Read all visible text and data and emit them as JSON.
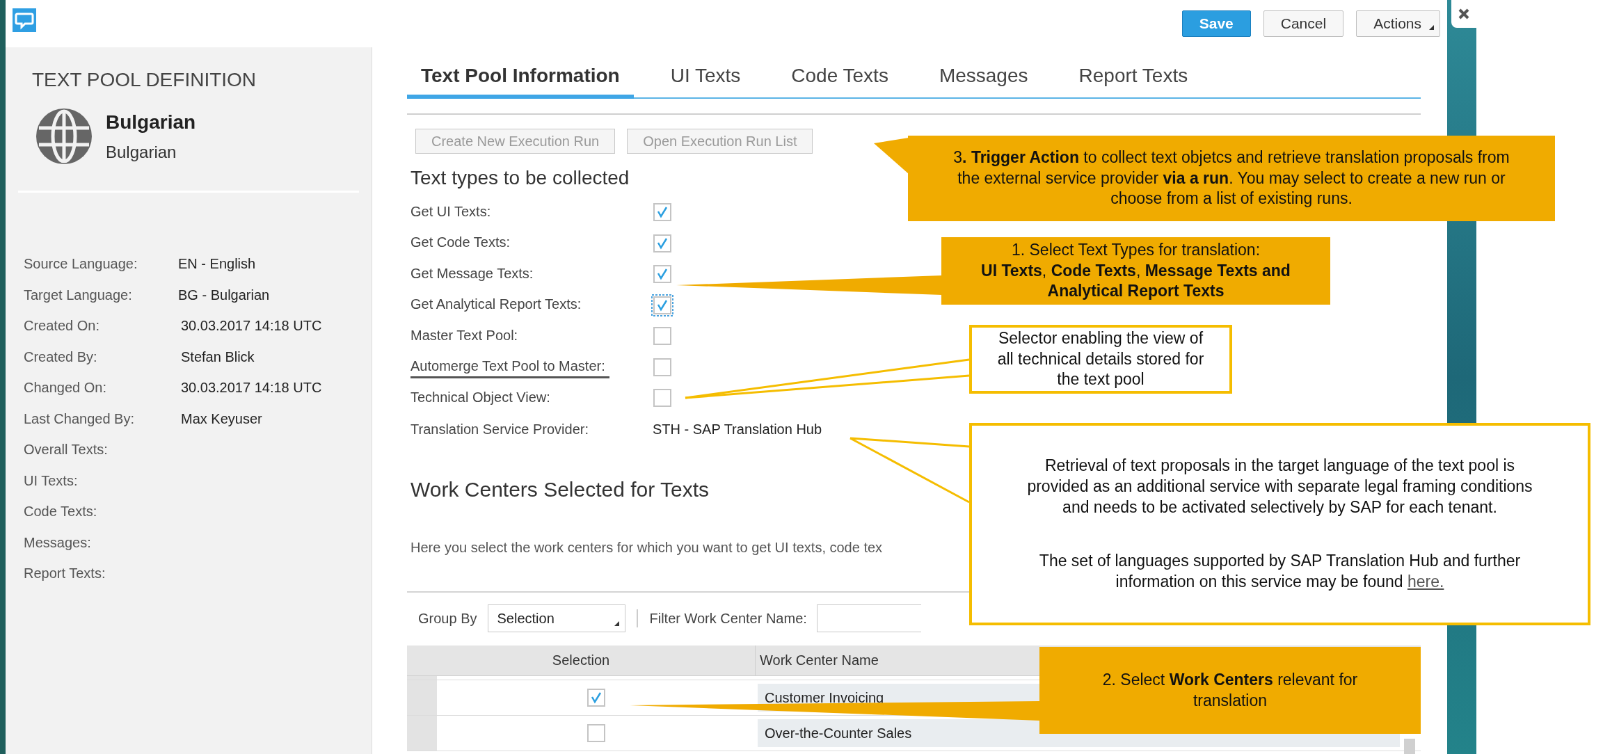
{
  "header": {
    "buttons": [
      {
        "label": "Save",
        "kind": "primary"
      },
      {
        "label": "Cancel",
        "kind": "default"
      },
      {
        "label": "Actions",
        "kind": "menu"
      }
    ]
  },
  "sidebar": {
    "title": "TEXT POOL DEFINITION",
    "language": {
      "name": "Bulgarian",
      "subtitle": "Bulgarian"
    },
    "fields": [
      {
        "label": "Source Language:",
        "value": "EN - English"
      },
      {
        "label": "Target Language:",
        "value": "BG - Bulgarian"
      },
      {
        "label": "Created On:",
        "value": "30.03.2017 14:18 UTC"
      },
      {
        "label": "Created By:",
        "value": "Stefan Blick"
      },
      {
        "label": "Changed On:",
        "value": "30.03.2017 14:18 UTC"
      },
      {
        "label": "Last Changed By:",
        "value": "Max Keyuser"
      },
      {
        "label": "Overall Texts:"
      },
      {
        "label": "UI Texts:"
      },
      {
        "label": "Code Texts:"
      },
      {
        "label": "Messages:"
      },
      {
        "label": "Report Texts:"
      }
    ]
  },
  "tabs": [
    {
      "label": "Text Pool Information",
      "selected": true
    },
    {
      "label": "UI Texts",
      "selected": false
    },
    {
      "label": "Code Texts",
      "selected": false
    },
    {
      "label": "Messages",
      "selected": false
    },
    {
      "label": "Report Texts",
      "selected": false
    }
  ],
  "actions": [
    {
      "label": "Create New Execution Run",
      "disabled": true
    },
    {
      "label": "Open Execution Run List",
      "disabled": true
    }
  ],
  "text_types": {
    "heading": "Text types to be collected",
    "options": [
      {
        "label": "Get UI Texts:",
        "checked": true,
        "focused": false,
        "highlighted": false
      },
      {
        "label": "Get Code Texts:",
        "checked": true,
        "focused": false,
        "highlighted": false
      },
      {
        "label": "Get Message Texts:",
        "checked": true,
        "focused": false,
        "highlighted": false
      },
      {
        "label": "Get Analytical Report Texts:",
        "checked": true,
        "focused": true,
        "highlighted": false
      },
      {
        "label": "Master Text Pool:",
        "checked": false,
        "focused": false,
        "highlighted": false
      },
      {
        "label": "Automerge Text Pool to Master:",
        "checked": false,
        "focused": false,
        "highlighted": true
      },
      {
        "label": "Technical Object View:",
        "checked": false,
        "focused": false,
        "highlighted": false
      }
    ]
  },
  "provider": {
    "label": "Translation Service Provider:",
    "value": "STH - SAP Translation Hub"
  },
  "work_centers": {
    "heading": "Work Centers Selected for Texts",
    "description": "Here you select the work centers for which you want to get UI texts, code tex",
    "group_by": {
      "label": "Group By",
      "value": "Selection"
    },
    "filter": {
      "label": "Filter Work Center Name:"
    },
    "columns": [
      "Selection",
      "Work Center Name"
    ],
    "rows": [
      {
        "checked": true,
        "name": "Customer Invoicing"
      },
      {
        "checked": false,
        "name": "Over-the-Counter Sales"
      }
    ]
  },
  "callouts": [
    {
      "kind": "filled",
      "paragraphs": [
        {
          "text": "3**. Trigger Action** to collect text objetcs and retrieve translation proposals from the external service provider **via a run**. You may select to create a new run or choose from a list of existing runs."
        }
      ]
    },
    {
      "kind": "filled",
      "paragraphs": [
        {
          "text": "1. Select Text Types for translation:"
        },
        {
          "text": "**UI Texts**, **Code Texts**, **Message Texts and Analytical Report Texts**"
        }
      ]
    },
    {
      "kind": "outlined",
      "paragraphs": [
        {
          "text": "Selector enabling the view of all technical details stored for the text pool"
        }
      ]
    },
    {
      "kind": "outlined",
      "paragraphs": [
        {
          "text": "Retrieval of text proposals in the target language of the text pool is provided as an additional service with separate legal framing conditions and needs to be activated selectively by SAP for each tenant."
        },
        {
          "text": "The set of languages supported by SAP Translation Hub and further information on this service may be found",
          "link": "here."
        }
      ]
    },
    {
      "kind": "filled",
      "paragraphs": [
        {
          "text": "2. Select **Work Centers** relevant for translation"
        }
      ]
    }
  ]
}
